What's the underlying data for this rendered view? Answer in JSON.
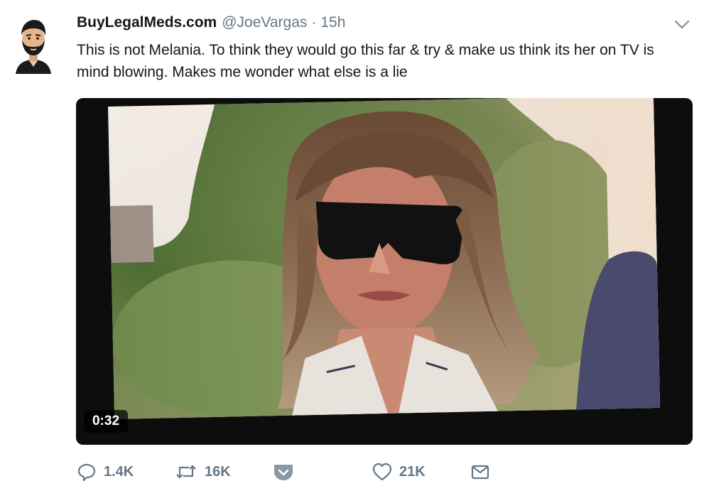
{
  "tweet": {
    "display_name": "BuyLegalMeds.com",
    "handle": "@JoeVargas",
    "separator": "·",
    "timestamp": "15h",
    "text": "This is not Melania. To think they would go this far & try & make us think its her on TV is mind blowing. Makes me wonder what else is a lie",
    "media": {
      "duration": "0:32"
    },
    "actions": {
      "replies": "1.4K",
      "retweets": "16K",
      "likes": "21K"
    }
  },
  "colors": {
    "text_primary": "#14171a",
    "text_secondary": "#657786",
    "media_bg": "#0d0d0d"
  },
  "icons": [
    "avatar",
    "chevron-down-icon",
    "reply-icon",
    "retweet-icon",
    "save-icon",
    "like-icon",
    "direct-message-icon"
  ]
}
